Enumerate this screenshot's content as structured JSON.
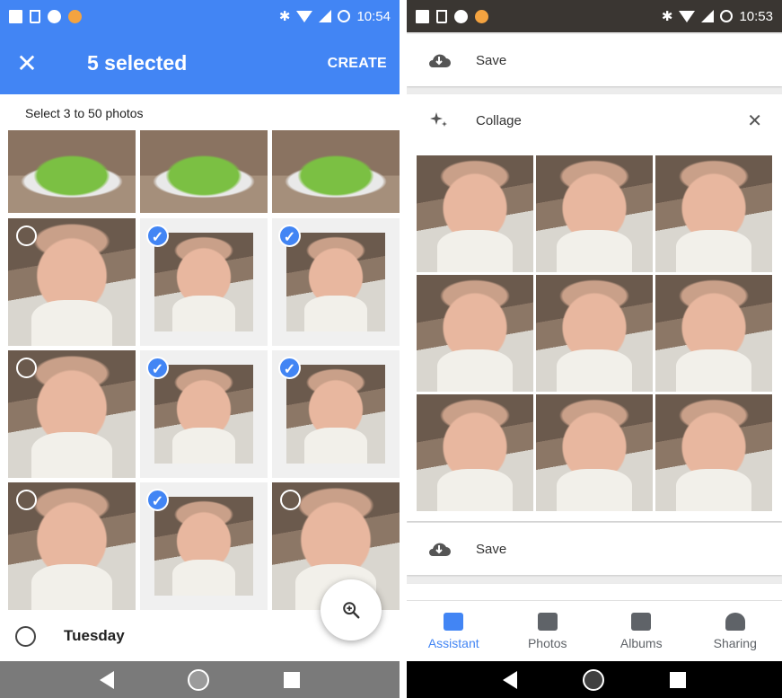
{
  "left": {
    "status": {
      "time": "10:54"
    },
    "appbar": {
      "close_label": "✕",
      "title": "5 selected",
      "create_label": "CREATE"
    },
    "hint": "Select 3 to 50 photos",
    "grid_rows": [
      [
        "unselected-toy",
        "unselected-toy",
        "unselected-toy"
      ],
      [
        "unselected",
        "selected",
        "selected"
      ],
      [
        "unselected",
        "selected",
        "selected"
      ],
      [
        "unselected",
        "selected",
        "unselected"
      ]
    ],
    "day_label": "Tuesday"
  },
  "right": {
    "status": {
      "time": "10:53"
    },
    "save_label_top": "Save",
    "collage_label": "Collage",
    "save_label_bottom": "Save",
    "tabs": [
      {
        "label": "Assistant",
        "icon": "assistant-icon",
        "active": true
      },
      {
        "label": "Photos",
        "icon": "photos-icon",
        "active": false
      },
      {
        "label": "Albums",
        "icon": "albums-icon",
        "active": false
      },
      {
        "label": "Sharing",
        "icon": "sharing-icon",
        "active": false
      }
    ]
  },
  "colors": {
    "accent": "#4285f4",
    "navbar_left": "#7a7a7a",
    "navbar_right": "#000000"
  }
}
